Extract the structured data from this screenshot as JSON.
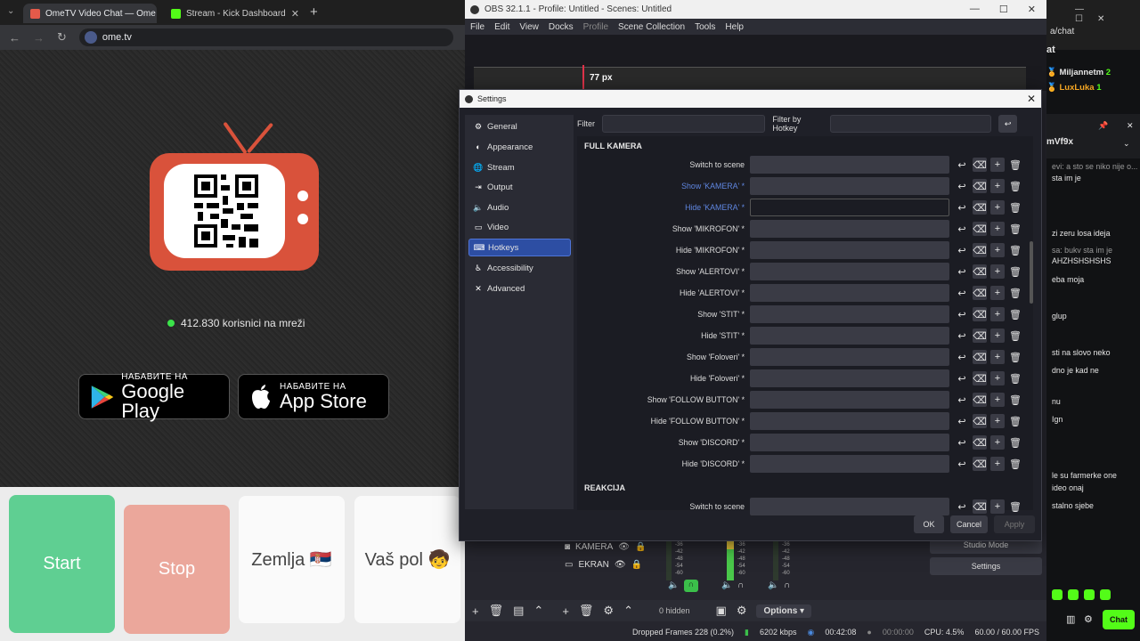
{
  "chrome": {
    "tabs": [
      {
        "title": "OmeTV Video Chat — Ome"
      },
      {
        "title": "Stream - Kick Dashboard"
      }
    ],
    "new_tab": "+",
    "url": "ome.tv"
  },
  "ometv": {
    "online_text": "412.830 korisnici na mreži",
    "google_play": {
      "small": "НАБАВИТЕ НА",
      "big": "Google Play"
    },
    "app_store": {
      "small": "НАБАВИТЕ НА",
      "big": "App Store"
    },
    "buttons": {
      "start": "Start",
      "stop": "Stop",
      "country": "Zemlja 🇷🇸",
      "gender": "Vaš pol 🧒"
    }
  },
  "obs": {
    "window_title": "OBS 32.1.1 - Profile: Untitled - Scenes: Untitled",
    "menu": [
      "File",
      "Edit",
      "View",
      "Docks",
      "Profile",
      "Scene Collection",
      "Tools",
      "Help"
    ],
    "preview_badge": "77 px",
    "sources": [
      {
        "name": "KAMERA"
      },
      {
        "name": "EKRAN"
      }
    ],
    "hidden_label": "0 hidden",
    "options_label": "Options",
    "studio_mode": "Studio Mode",
    "settings_button": "Settings",
    "meter_labels": [
      "-36",
      "-42",
      "-48",
      "-54",
      "-60"
    ],
    "status": {
      "dropped": "Dropped Frames 228 (0.2%)",
      "bitrate": "6202 kbps",
      "stream_time": "00:42:08",
      "rec_time": "00:00:00",
      "cpu": "CPU: 4.5%",
      "fps": "60.00 / 60.00 FPS"
    }
  },
  "settings": {
    "title": "Settings",
    "nav": [
      {
        "label": "General",
        "icon": "gear-icon"
      },
      {
        "label": "Appearance",
        "icon": "appearance-icon"
      },
      {
        "label": "Stream",
        "icon": "globe-icon"
      },
      {
        "label": "Output",
        "icon": "output-icon"
      },
      {
        "label": "Audio",
        "icon": "speaker-icon"
      },
      {
        "label": "Video",
        "icon": "monitor-icon"
      },
      {
        "label": "Hotkeys",
        "icon": "keyboard-icon"
      },
      {
        "label": "Accessibility",
        "icon": "accessibility-icon"
      },
      {
        "label": "Advanced",
        "icon": "tools-icon"
      }
    ],
    "selected": "Hotkeys",
    "filter_label": "Filter",
    "filter_hotkey_label": "Filter by Hotkey",
    "groups": [
      {
        "name": "FULL KAMERA",
        "rows": [
          {
            "label": "Switch to scene"
          },
          {
            "label": "Show 'KAMERA' *",
            "highlight": true
          },
          {
            "label": "Hide 'KAMERA' *",
            "highlight": true,
            "active": true
          },
          {
            "label": "Show 'MIKROFON' *"
          },
          {
            "label": "Hide 'MIKROFON' *"
          },
          {
            "label": "Show 'ALERTOVI' *"
          },
          {
            "label": "Hide 'ALERTOVI' *"
          },
          {
            "label": "Show 'STIT' *"
          },
          {
            "label": "Hide 'STIT' *"
          },
          {
            "label": "Show 'Foloveri' *"
          },
          {
            "label": "Hide 'Foloveri' *"
          },
          {
            "label": "Show 'FOLLOW BUTTON' *"
          },
          {
            "label": "Hide 'FOLLOW BUTTON' *"
          },
          {
            "label": "Show 'DISCORD' *"
          },
          {
            "label": "Hide 'DISCORD' *"
          }
        ]
      },
      {
        "name": "REAKCIJA",
        "rows": [
          {
            "label": "Switch to scene"
          }
        ]
      }
    ],
    "ok": "OK",
    "cancel": "Cancel",
    "apply": "Apply"
  },
  "kick": {
    "url_fragment": "a/chat",
    "header": "at",
    "users": [
      {
        "name": "Miljannetm",
        "count": "2",
        "color": "#ffffff"
      },
      {
        "name": "LuxLuka",
        "count": "1",
        "color": "#f5a623"
      }
    ],
    "pinned_user": "mVf9x",
    "messages": [
      "evi: a sto se niko nije o...",
      "sta im je",
      "zi zeru losa ideja",
      "sa: bukv sta im je",
      "AHZHSHSHSHS",
      "eba moja",
      "glup",
      "sti na slovo neko",
      "dno je kad ne",
      "nu",
      "Ign",
      "le su farmerke one",
      "ideo onaj",
      "stalno sjebe"
    ],
    "chat_button": "Chat"
  },
  "colors": {
    "start": "#5fcf92",
    "stop": "#eba79b",
    "tv": "#d9523b",
    "hotkey_selected": "#2d4ea3",
    "kick_green": "#53fc18"
  }
}
